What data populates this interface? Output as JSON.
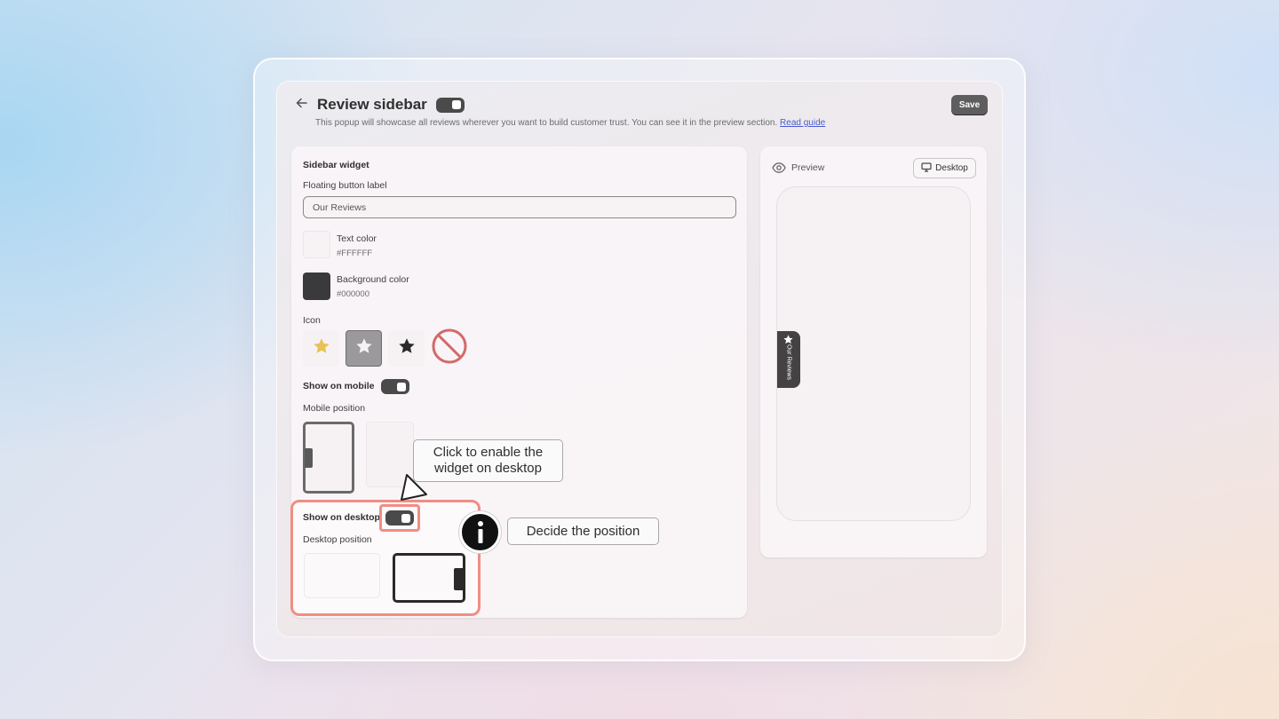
{
  "header": {
    "back_icon": "arrow-left-icon",
    "title": "Review sidebar",
    "title_toggle_on": true,
    "subtitle": "This popup will showcase all reviews wherever you want to build customer trust. You can see it in the preview section.",
    "guide_link": "Read guide",
    "save_label": "Save"
  },
  "widget": {
    "section_title": "Sidebar widget",
    "floating_label_title": "Floating button label",
    "floating_label_value": "Our Reviews",
    "text_color_label": "Text color",
    "text_color_value": "#FFFFFF",
    "bg_color_label": "Background color",
    "bg_color_value": "#000000",
    "icon_label": "Icon",
    "icons": [
      "star-filled-yellow-icon",
      "star-white-selected-icon",
      "star-black-icon",
      "none-icon"
    ],
    "selected_icon_index": 1,
    "show_mobile_label": "Show on mobile",
    "show_mobile_on": true,
    "mobile_position_label": "Mobile position",
    "show_desktop_label": "Show on desktop",
    "show_desktop_on": true,
    "desktop_position_label": "Desktop position"
  },
  "preview": {
    "title": "Preview",
    "eye_icon": "eye-icon",
    "device_button": "Desktop",
    "device_icon": "monitor-icon",
    "tab_text": "Our Reviews"
  },
  "callouts": {
    "toggle_tip": "Click to enable the widget on desktop",
    "position_tip": "Decide the position",
    "info_icon": "info-icon",
    "pointer_icon": "cursor-pointer-icon"
  },
  "colors": {
    "highlight": "#ef8e84",
    "toggle_bg": "#4a4a4a",
    "link": "#4a5bd0"
  }
}
